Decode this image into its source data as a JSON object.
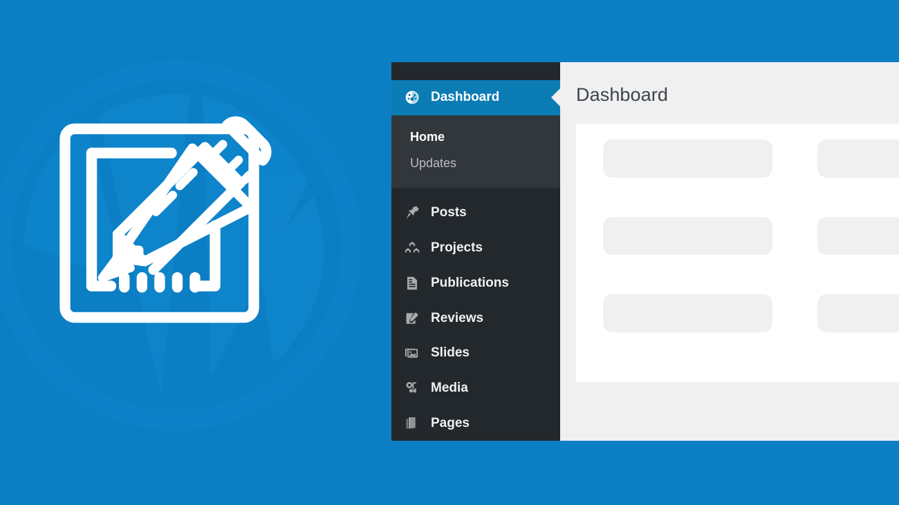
{
  "brand": {
    "accent_blue": "#0b7ec4",
    "admin_blue": "#0c7cb5",
    "sidebar_dark": "#23282d",
    "submenu_gray": "#32373c",
    "content_gray": "#f0f0f1",
    "hero_icon_name": "edit-document-pencil-icon",
    "watermark_name": "wordpress-logo-watermark"
  },
  "window": {
    "sidebar": {
      "menu": [
        {
          "label": "Dashboard",
          "icon": "dashboard-gauge-icon",
          "current": true
        },
        {
          "label": "Posts",
          "icon": "pushpin-icon",
          "current": false
        },
        {
          "label": "Projects",
          "icon": "portfolio-icon",
          "current": false
        },
        {
          "label": "Publications",
          "icon": "document-icon",
          "current": false
        },
        {
          "label": "Reviews",
          "icon": "edit-page-icon",
          "current": false
        },
        {
          "label": "Slides",
          "icon": "images-stack-icon",
          "current": false
        },
        {
          "label": "Media",
          "icon": "media-icon",
          "current": false
        },
        {
          "label": "Pages",
          "icon": "pages-icon",
          "current": false
        }
      ],
      "submenu": [
        {
          "label": "Home",
          "current": true
        },
        {
          "label": "Updates",
          "current": false
        }
      ]
    },
    "content": {
      "page_title": "Dashboard",
      "skeleton": {
        "rows": 3,
        "columns": 2,
        "box_label": ""
      }
    }
  }
}
